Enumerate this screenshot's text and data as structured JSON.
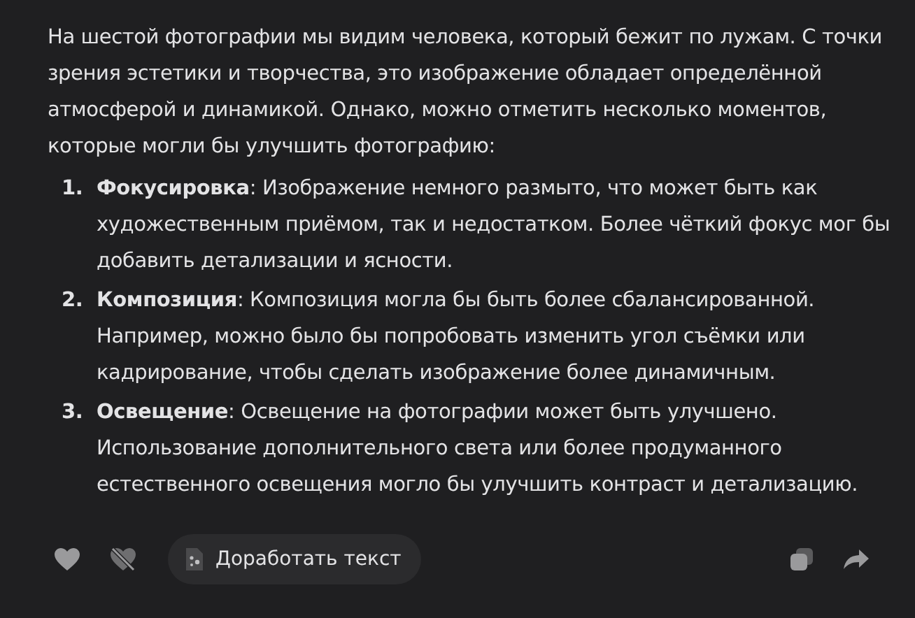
{
  "message": {
    "intro": "На шестой фотографии мы видим человека, который бежит по лужам. С точки зрения эстетики и творчества, это изображение обладает определённой атмосферой и динамикой. Однако, можно отметить несколько моментов, которые могли бы улучшить фотографию:",
    "items": [
      {
        "number": "1.",
        "text": "**Фокусировка**: Изображение немного размыто, что может быть как художественным приёмом, так и недостатком. Более чёткий фокус мог бы добавить детализации и ясности."
      },
      {
        "number": "2.",
        "text": "**Композиция**: Композиция могла бы быть более сбалансированной. Например, можно было бы попробовать изменить угол съёмки или кадрирование, чтобы сделать изображение более динамичным."
      },
      {
        "number": "3.",
        "text": "**Освещение**: Освещение на фотографии может быть улучшено. Использование дополнительного света или более продуманного естественного освещения могло бы улучшить контраст и детализацию."
      }
    ]
  },
  "actions": {
    "improve_button": "Доработать текст"
  }
}
